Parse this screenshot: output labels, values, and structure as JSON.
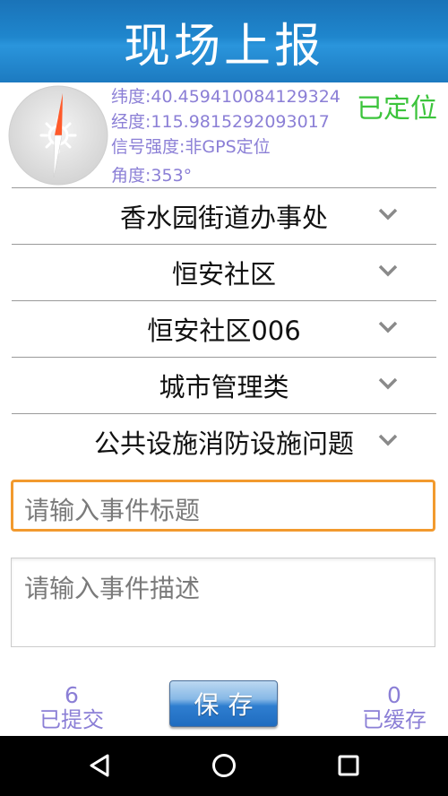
{
  "header": {
    "title": "现场上报"
  },
  "location": {
    "latitude": "纬度:40.459410084129324",
    "longitude": "经度:115.9815292093017",
    "signal": "信号强度:非GPS定位",
    "angle": "角度:353°",
    "status": "已定位"
  },
  "selectors": [
    {
      "label": "香水园街道办事处"
    },
    {
      "label": "恒安社区"
    },
    {
      "label": "恒安社区006"
    },
    {
      "label": "城市管理类"
    },
    {
      "label": "公共设施消防设施问题"
    }
  ],
  "form": {
    "title_placeholder": "请输入事件标题",
    "description_placeholder": "请输入事件描述"
  },
  "footer": {
    "submitted_count": "6",
    "submitted_label": "已提交",
    "save_label": "保存",
    "cached_count": "0",
    "cached_label": "已缓存"
  },
  "colors": {
    "header": "#1f86cd",
    "info_text": "#8b7fd6",
    "located": "#3cc43c",
    "focus_border": "#f29a2e"
  },
  "icons": {
    "compass": "compass-icon",
    "dropdown": "chevron-down-icon",
    "back": "back-triangle-icon",
    "home": "home-circle-icon",
    "recents": "recents-square-icon"
  }
}
